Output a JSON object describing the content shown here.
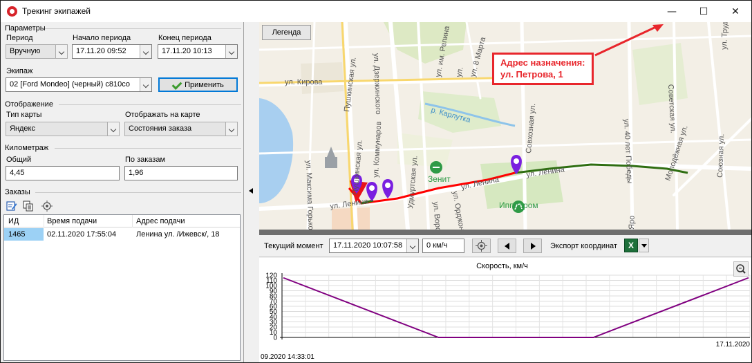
{
  "window": {
    "title": "Трекинг экипажей",
    "minimize_icon": "minimize-icon",
    "maximize_icon": "maximize-icon",
    "close_icon": "close-icon",
    "min_glyph": "—",
    "max_glyph": "☐",
    "close_glyph": "✕"
  },
  "params": {
    "group": "Параметры",
    "period_label": "Период",
    "period_value": "Вручную",
    "start_label": "Начало периода",
    "start_value": "17.11.20 09:52",
    "end_label": "Конец периода",
    "end_value": "17.11.20 10:13",
    "crew_label": "Экипаж",
    "crew_value": "02 [Ford Mondeo] (черный) с810со",
    "apply_label": "Применить"
  },
  "display": {
    "group": "Отображение",
    "map_type_label": "Тип карты",
    "map_type_value": "Яндекс",
    "show_label": "Отображать на карте",
    "show_value": "Состояния заказа"
  },
  "mileage": {
    "group": "Километраж",
    "total_label": "Общий",
    "total_value": "4,45",
    "orders_label": "По заказам",
    "orders_value": "1,96"
  },
  "orders": {
    "group": "Заказы",
    "columns": [
      "ИД",
      "Время подачи",
      "Адрес подачи"
    ],
    "rows": [
      {
        "id": "1465",
        "time": "02.11.2020 17:55:04",
        "address": "Ленина ул. /Ижевск/, 18"
      }
    ]
  },
  "map": {
    "legend_label": "Легенда",
    "callout_line1": "Адрес назначения:",
    "callout_line2": "ул. Петрова, 1",
    "labels": {
      "kirova": "ул. Кирова",
      "pushkinskaya": "Пушкинская ул.",
      "pushkinskaya2": "Пушкинская ул.",
      "kommunarov": "ул. Коммунаров",
      "udmurtskaya": "Удмуртская ул.",
      "repina": "ул. им. Репина",
      "marta": "ул. 8 Марта",
      "ul": "ул.",
      "karlutka": "р. Карлутка",
      "sovkhoznaya": "Совхозная ул.",
      "lenina1": "ул. Ленина",
      "lenina2": "ул. Ленина",
      "lenina3": "ул. Ленина",
      "pobedy": "ул. 40 лет Победы",
      "molodezhnaya": "Молодёжная ул.",
      "soyuznaya": "Союзная ул.",
      "sovetskaya": "Советская ул.",
      "maksima": "ул. Максима Горького",
      "vorovskogo": "ул. Воровского",
      "ordzhonikidze": "ул. Орджоникидзе",
      "zenit": "Зенит",
      "ippodrom": "Ипподром",
      "truda": "ул. Труда",
      "dzerzhinskogo": "ул. Дзержинского",
      "yaroslava": "Яро"
    },
    "colors": {
      "route_red": "#ff0000",
      "route_green": "#2f6e12",
      "marker": "#7a1fe0",
      "callout": "#e8262c"
    }
  },
  "controls": {
    "current_moment_label": "Текущий момент",
    "current_moment_value": "17.11.2020 10:07:58",
    "speed_value": "0 км/ч",
    "export_label": "Экспорт координат",
    "excel_glyph": "X"
  },
  "chart_data": {
    "type": "line",
    "title": "Скорость, км/ч",
    "yticks": [
      0,
      10,
      20,
      30,
      40,
      50,
      60,
      70,
      80,
      90,
      100,
      110,
      120
    ],
    "ylim": [
      0,
      120
    ],
    "x_start_label": "09.2020 14:33:01",
    "x_end_label": "17.11.2020",
    "series": [
      {
        "values": [
          115,
          0,
          0,
          115
        ]
      }
    ],
    "grid": true,
    "line_color": "#800080"
  }
}
